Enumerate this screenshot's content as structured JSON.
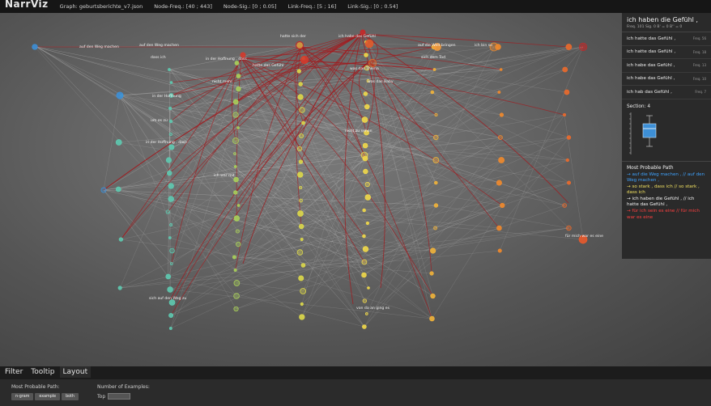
{
  "app": {
    "title": "NarrViz",
    "graph": "Graph: geburtsberichte_v7.json",
    "node_freq": "Node-Freq.: [40 ; 443]",
    "node_sig": "Node-Sig.: [0 ; 0.05]",
    "link_freq": "Link-Freq.: [5 ; 16]",
    "link_sig": "Link-Sig.: [0 ; 0.54]"
  },
  "graph_labels": [
    "auf den Weg machen",
    "auf den Weg machen",
    "hatte sich der",
    "ich habe das Gefühl",
    "auf die Welt bringen",
    "ich bin so",
    "dass ich",
    "in der Hoffnung , dass",
    "hatte das Gefühl",
    "sich dem Tod",
    "was das Thema",
    "nicht mehr",
    "was das Baby",
    "in der Hoffnung",
    "um es zu",
    "in der Hoffnung , dass",
    "ich war mit",
    "sich auf den Weg zu",
    "für mich war es eine",
    "nicht zu sehen",
    "von da an ging es"
  ],
  "panel": {
    "title": "ich haben die Gefühl ,",
    "stats": "Freq. 101   Sig. 0   B' = 0   B'' = 0",
    "examples": [
      {
        "text": "ich hatte das Gefühl ,",
        "freq": "Freq. 56"
      },
      {
        "text": "ich hatte das Gefühl ,",
        "freq": "Freq. 18"
      },
      {
        "text": "ich habe das Gefühl ,",
        "freq": "Freq. 13"
      },
      {
        "text": "ich habe das Gefühl ,",
        "freq": "Freq. 10"
      },
      {
        "text": "ich hab das Gefühl ,",
        "freq": "Freq. 7"
      }
    ],
    "section_label": "Section: 4",
    "mpp_title": "Most Probable Path",
    "mpp": [
      {
        "text": "→ auf die Weg machen , // auf den Weg machen ,",
        "color": "#3fa3ff"
      },
      {
        "text": "→ so stark , dass ich // so stark , dass ich",
        "color": "#f0e060"
      },
      {
        "text": "→ ich haben die Gefühl , // ich hatte das Gefühl ,",
        "color": "#f5f5f5"
      },
      {
        "text": "→ für ich sein es eine // für mich war es eine",
        "color": "#ff4040"
      }
    ]
  },
  "bottom": {
    "tabs": [
      "Filter",
      "Tooltip",
      "Layout"
    ],
    "active_tab": "Layout",
    "mpp_label": "Most Probable Path:",
    "mpp_buttons": [
      "n-gram",
      "example",
      "both"
    ],
    "nex_label": "Number of Examples:",
    "top_label": "Top"
  },
  "colors": {
    "edge_red": "#a3191d",
    "edge_light": "#d8d8d8",
    "blue": "#3d8fd6",
    "teal": "#5ec9b0",
    "yellow": "#f0d84a",
    "orange": "#f0892c",
    "red": "#c62828"
  }
}
